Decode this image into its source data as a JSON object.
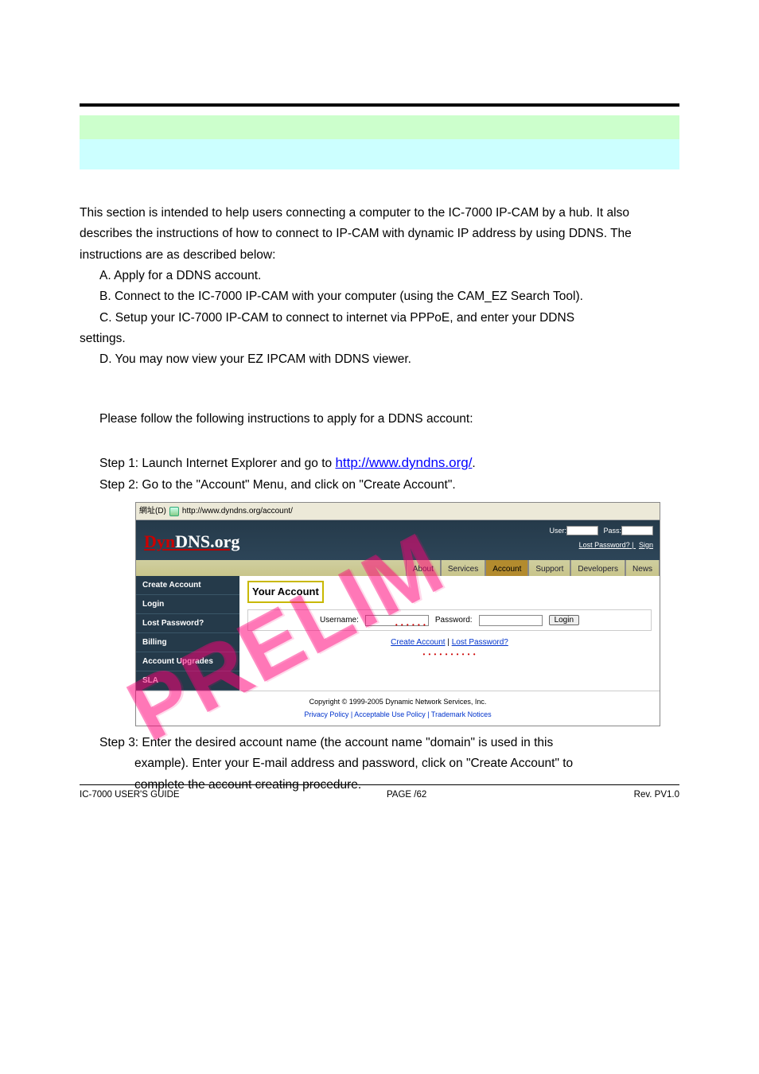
{
  "intro": {
    "p1": "This section is intended to help users connecting a computer to the IC-7000 IP-CAM by a hub. It also describes the instructions of how to connect to IP-CAM with dynamic IP address by using DDNS. The instructions are as described below:",
    "a": "A. Apply for a DDNS account.",
    "b": "B. Connect to the IC-7000 IP-CAM with your computer (using the CAM_EZ Search Tool).",
    "c1": "C. Setup your IC-7000 IP-CAM to connect to internet via PPPoE, and enter your DDNS",
    "c2": "settings.",
    "d": "D. You may now view your EZ IPCAM with DDNS viewer."
  },
  "apply_intro": "Please follow the following instructions to apply for a DDNS account:",
  "step1_a": "Step 1: Launch Internet Explorer and go to ",
  "step1_link": "http://www.dyndns.org/",
  "step1_b": ".",
  "step2": "Step 2: Go to the \"Account\" Menu, and click on \"Create Account\".",
  "screenshot": {
    "addr_label": "網址(D)",
    "addr_url": "http://www.dyndns.org/account/",
    "logo_dyn": "Dyn",
    "logo_rest": "DNS.org",
    "top_user": "User:",
    "top_pass": "Pass:",
    "top_lost": "Lost Password?",
    "top_sign": "Sign",
    "tabs": [
      "About",
      "Services",
      "Account",
      "Support",
      "Developers",
      "News"
    ],
    "side": [
      "Create Account",
      "Login",
      "Lost Password?",
      "Billing",
      "Account Upgrades",
      "SLA"
    ],
    "main_title": "Your Account",
    "username_label": "Username:",
    "password_label": "Password:",
    "login_btn": "Login",
    "create_link": "Create Account",
    "lost_link": "Lost Password?",
    "sep": " | ",
    "copyright": "Copyright © 1999-2005 Dynamic Network Services, Inc.",
    "foot_links": "Privacy Policy  |  Acceptable Use Policy  |  Trademark Notices"
  },
  "step3_a": "Step 3: Enter the desired account name (the account name \"domain\" is used in this",
  "step3_b": "example). Enter your E-mail address and password, click on \"Create Account\" to",
  "step3_c": "complete the account creating procedure.",
  "watermark": "PRELIM",
  "footer": {
    "left": "IC-7000 USER'S GUIDE",
    "center_a": "PAGE ",
    "center_b": "/62",
    "right": "Rev. PV1.0"
  }
}
